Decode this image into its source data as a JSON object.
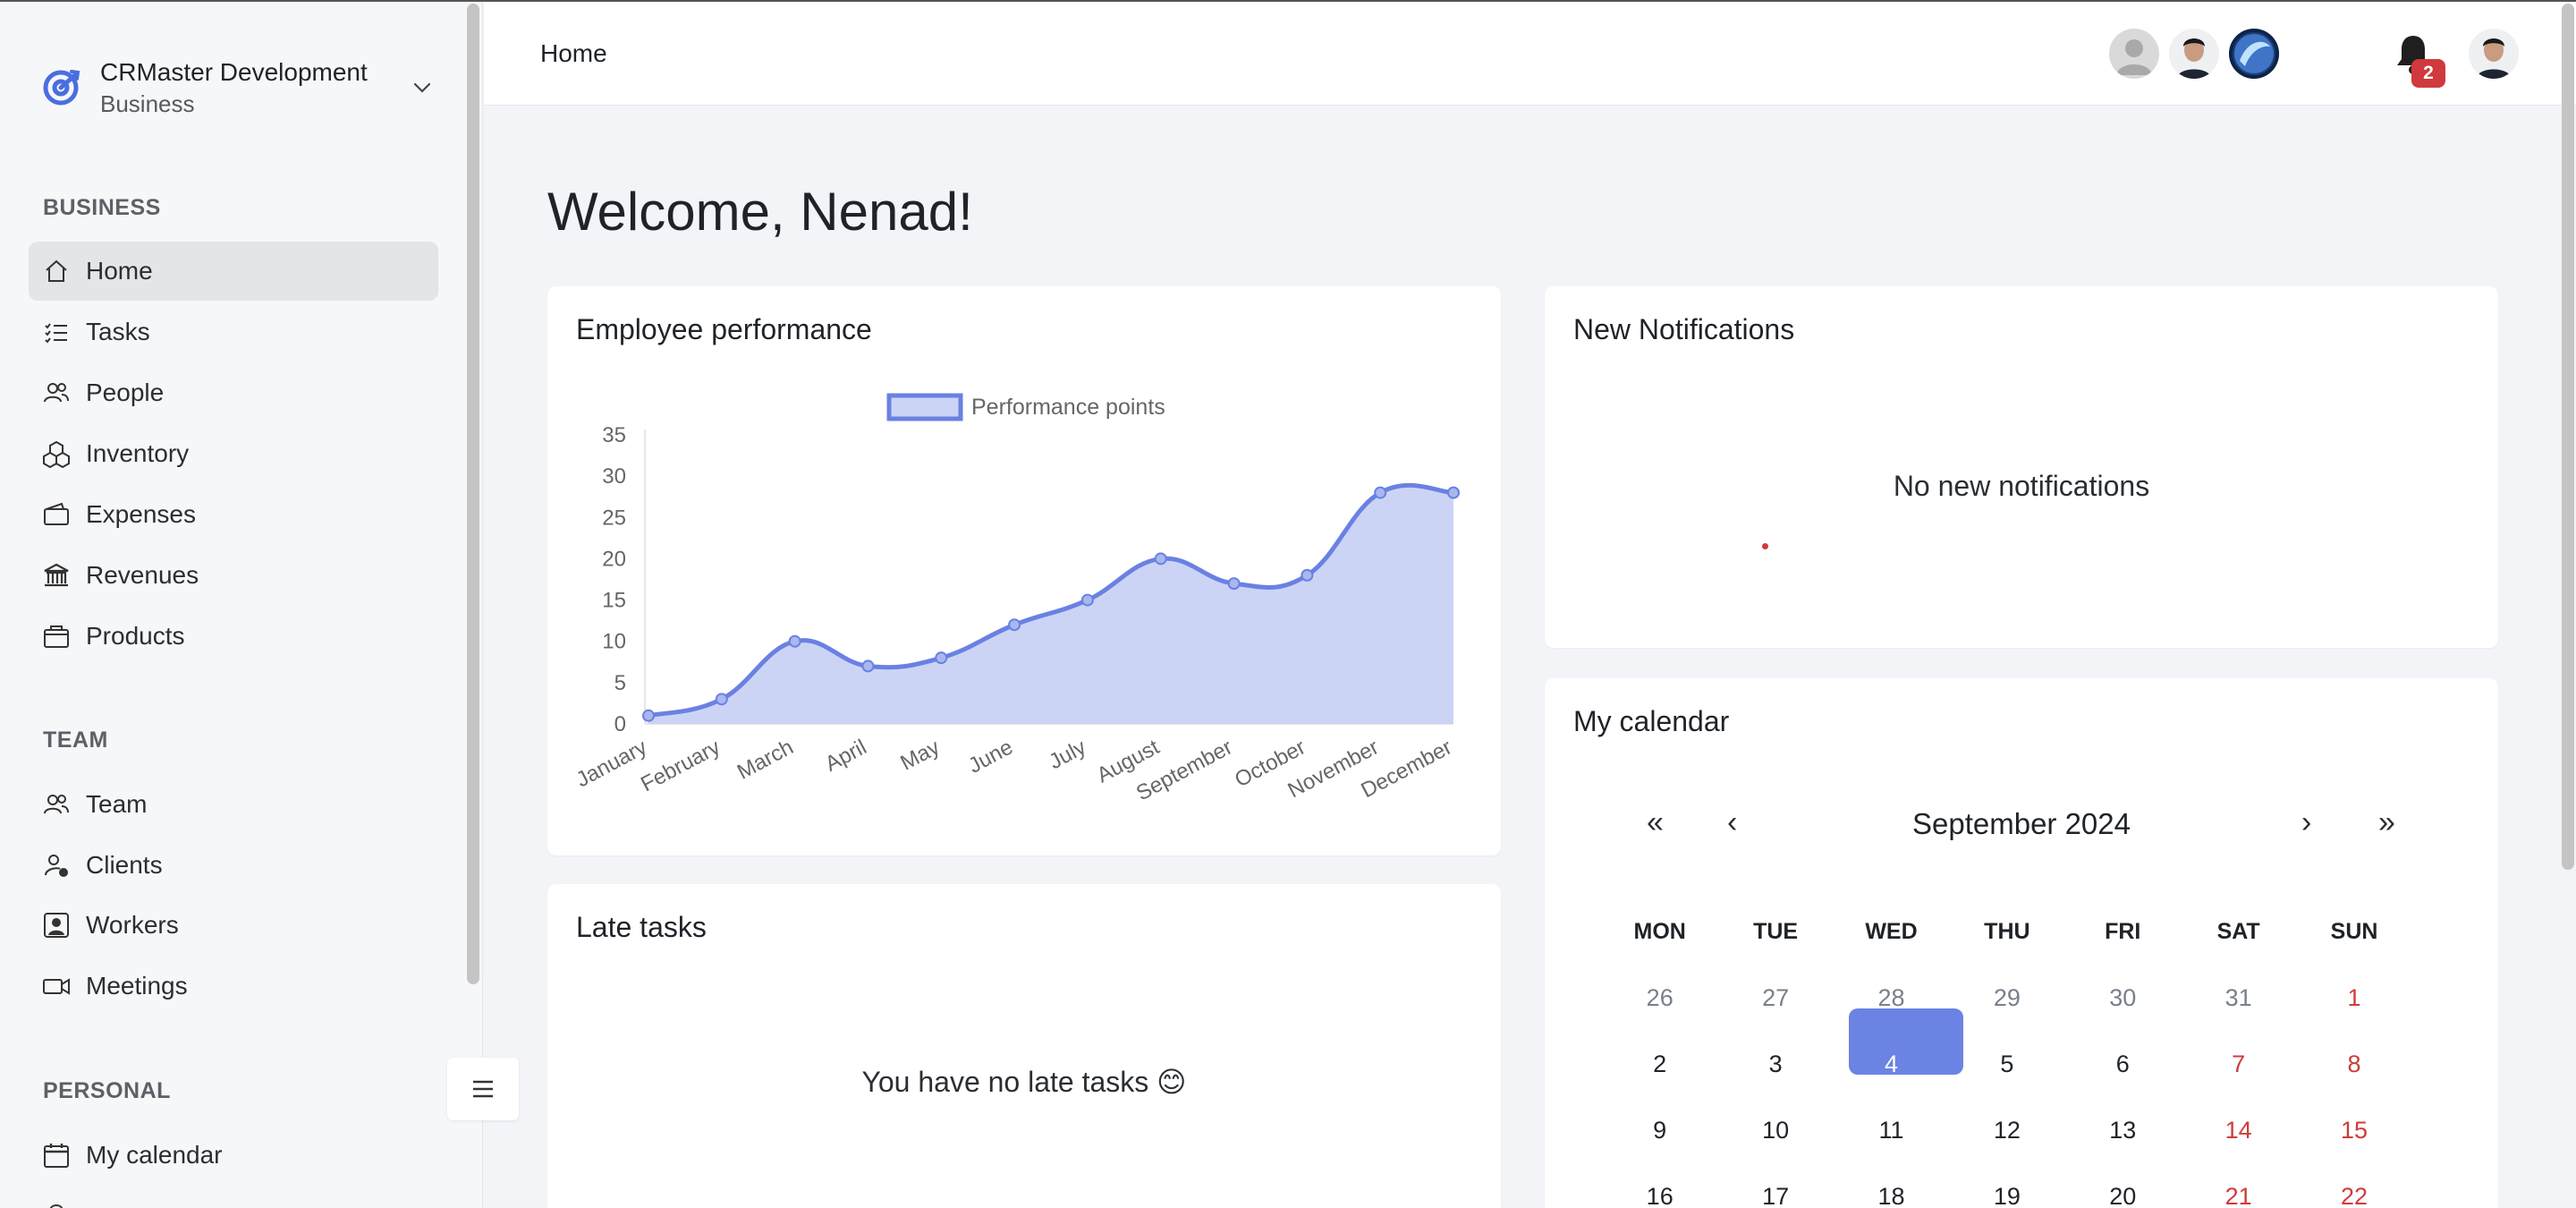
{
  "sidebar": {
    "org_name": "CRMaster Development",
    "org_type": "Business",
    "sections": {
      "business": "BUSINESS",
      "team": "TEAM",
      "personal": "PERSONAL"
    },
    "business_items": [
      {
        "label": "Home",
        "icon": "home-icon",
        "active": true
      },
      {
        "label": "Tasks",
        "icon": "tasks-icon"
      },
      {
        "label": "People",
        "icon": "people-icon"
      },
      {
        "label": "Inventory",
        "icon": "inventory-icon"
      },
      {
        "label": "Expenses",
        "icon": "wallet-icon"
      },
      {
        "label": "Revenues",
        "icon": "bank-icon"
      },
      {
        "label": "Products",
        "icon": "box-icon"
      }
    ],
    "team_items": [
      {
        "label": "Team",
        "icon": "team-icon"
      },
      {
        "label": "Clients",
        "icon": "client-icon"
      },
      {
        "label": "Workers",
        "icon": "worker-icon"
      },
      {
        "label": "Meetings",
        "icon": "video-icon"
      }
    ],
    "personal_items": [
      {
        "label": "My calendar",
        "icon": "calendar-icon"
      }
    ]
  },
  "header": {
    "title": "Home",
    "notification_count": "2"
  },
  "main": {
    "welcome": "Welcome, Nenad!"
  },
  "performance_card": {
    "title": "Employee performance"
  },
  "chart_data": {
    "type": "area",
    "title": "",
    "xlabel": "",
    "ylabel": "",
    "categories": [
      "January",
      "February",
      "March",
      "April",
      "May",
      "June",
      "July",
      "August",
      "September",
      "October",
      "November",
      "December"
    ],
    "series": [
      {
        "name": "Performance points",
        "values": [
          1,
          3,
          10,
          7,
          8,
          12,
          15,
          20,
          17,
          18,
          28,
          28
        ]
      }
    ],
    "yticks": [
      "0",
      "5",
      "10",
      "15",
      "20",
      "25",
      "30",
      "35"
    ],
    "ylim": [
      0,
      35
    ],
    "legend": "top-center",
    "colors": {
      "line": "#6a81e3",
      "fill": "#ccd4f6"
    }
  },
  "notifications_card": {
    "title": "New Notifications",
    "empty": "No new notifications"
  },
  "late_tasks_card": {
    "title": "Late tasks",
    "empty": "You have no late tasks 😊"
  },
  "calendar_card": {
    "title": "My calendar",
    "month": "September 2024",
    "nav": {
      "prev_year": "«",
      "prev_month": "‹",
      "next_month": "›",
      "next_year": "»"
    },
    "weekdays": [
      "MON",
      "TUE",
      "WED",
      "THU",
      "FRI",
      "SAT",
      "SUN"
    ],
    "weeks": [
      [
        "26",
        "27",
        "28",
        "29",
        "30",
        "31",
        "1"
      ],
      [
        "2",
        "3",
        "4",
        "5",
        "6",
        "7",
        "8"
      ],
      [
        "9",
        "10",
        "11",
        "12",
        "13",
        "14",
        "15"
      ],
      [
        "16",
        "17",
        "18",
        "19",
        "20",
        "21",
        "22"
      ]
    ],
    "today": "4",
    "accent": "#6b83e3",
    "weekend_color": "#d03b3b"
  }
}
